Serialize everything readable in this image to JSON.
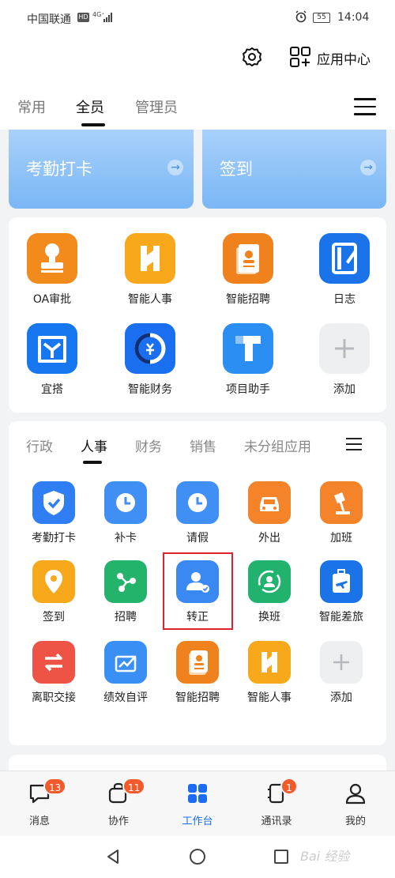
{
  "statusbar": {
    "carrier": "中国联通",
    "network_badge": "HD",
    "signal": "4G⁺",
    "battery": "55",
    "time": "14:04"
  },
  "header": {
    "app_center_label": "应用中心",
    "tabs": [
      {
        "label": "常用"
      },
      {
        "label": "全员"
      },
      {
        "label": "管理员"
      }
    ]
  },
  "banner": [
    {
      "label": "考勤打卡",
      "arrow": "→"
    },
    {
      "label": "签到",
      "arrow": "→"
    }
  ],
  "common_apps": [
    {
      "label": "OA审批",
      "icon": "stamp-icon",
      "color": "#f28a1c"
    },
    {
      "label": "智能人事",
      "icon": "h-letter-icon",
      "color": "#f7a81b"
    },
    {
      "label": "智能招聘",
      "icon": "resume-icon",
      "color": "#f0821d"
    },
    {
      "label": "日志",
      "icon": "notebook-icon",
      "color": "#1a73e8"
    },
    {
      "label": "宜搭",
      "icon": "yida-icon",
      "color": "#1677f0"
    },
    {
      "label": "智能财务",
      "icon": "finance-icon",
      "color": "#1a6ef0"
    },
    {
      "label": "项目助手",
      "icon": "t-letter-icon",
      "color": "#2b8ef2"
    },
    {
      "label": "添加",
      "icon": "plus-icon",
      "color": "#eeeff1"
    }
  ],
  "category": {
    "tabs": [
      {
        "label": "行政"
      },
      {
        "label": "人事"
      },
      {
        "label": "财务"
      },
      {
        "label": "销售"
      },
      {
        "label": "未分组应用"
      }
    ],
    "apps": [
      {
        "label": "考勤打卡",
        "icon": "check-shield-icon",
        "color": "#2f7ef4"
      },
      {
        "label": "补卡",
        "icon": "clock-icon",
        "color": "#3f8ff5"
      },
      {
        "label": "请假",
        "icon": "clock-icon",
        "color": "#3f8ff5"
      },
      {
        "label": "外出",
        "icon": "car-icon",
        "color": "#f5832a"
      },
      {
        "label": "加班",
        "icon": "desk-lamp-icon",
        "color": "#f5832a"
      },
      {
        "label": "签到",
        "icon": "location-pin-icon",
        "color": "#f7a81b"
      },
      {
        "label": "招聘",
        "icon": "share-nodes-icon",
        "color": "#23b36b"
      },
      {
        "label": "转正",
        "icon": "user-check-icon",
        "color": "#3a88f2"
      },
      {
        "label": "换班",
        "icon": "user-swap-icon",
        "color": "#21b26e"
      },
      {
        "label": "智能差旅",
        "icon": "luggage-plane-icon",
        "color": "#1a73e8"
      },
      {
        "label": "离职交接",
        "icon": "swap-arrows-icon",
        "color": "#ef5346"
      },
      {
        "label": "绩效自评",
        "icon": "chart-trend-icon",
        "color": "#3a8ff4"
      },
      {
        "label": "智能招聘",
        "icon": "resume-icon",
        "color": "#f0821d"
      },
      {
        "label": "智能人事",
        "icon": "h-letter-icon",
        "color": "#f7a81b"
      },
      {
        "label": "添加",
        "icon": "plus-icon",
        "color": "#eeeff1"
      }
    ]
  },
  "tabbar": [
    {
      "label": "消息",
      "badge": "13"
    },
    {
      "label": "协作",
      "badge": "11"
    },
    {
      "label": "工作台",
      "badge": ""
    },
    {
      "label": "通讯录",
      "badge": "1"
    },
    {
      "label": "我的",
      "badge": ""
    }
  ],
  "watermark": "Bai 经验",
  "accent_color": "#1b6cf2"
}
